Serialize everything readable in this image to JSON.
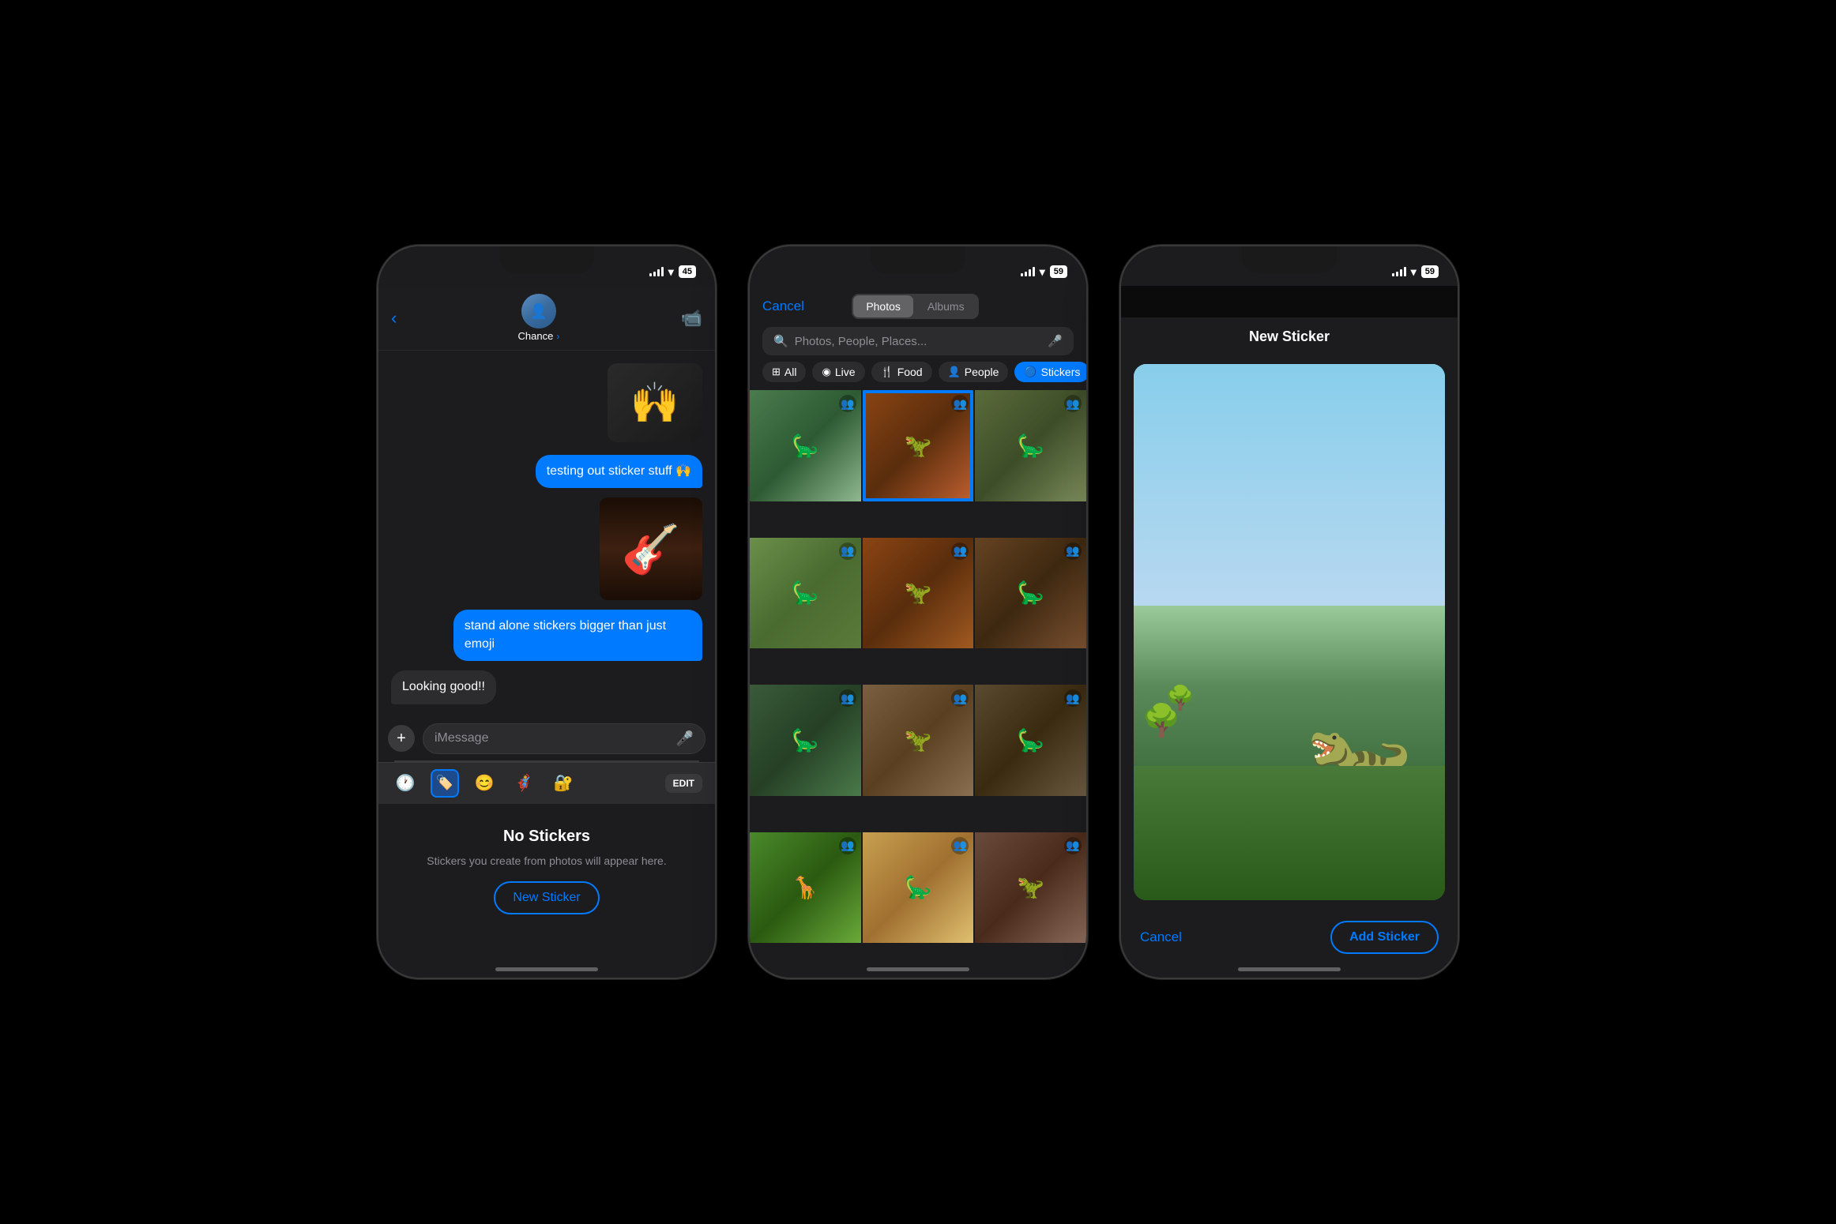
{
  "phone1": {
    "status_bar": {
      "time": "",
      "signal": "●●●●",
      "wifi": "wifi",
      "battery": "45"
    },
    "header": {
      "contact_name": "Chance",
      "contact_chevron": "›"
    },
    "messages": [
      {
        "type": "sent",
        "text": "testing out sticker stuff 🙌"
      },
      {
        "type": "sticker_sent",
        "emoji": "🎸"
      },
      {
        "type": "sent",
        "text": "stand alone stickers bigger than just emoji"
      },
      {
        "type": "received",
        "text": "Looking good!!"
      }
    ],
    "input_placeholder": "iMessage",
    "toolbar": {
      "edit_label": "EDIT"
    },
    "no_stickers": {
      "title": "No Stickers",
      "subtitle": "Stickers you create from photos\nwill appear here.",
      "button_label": "New Sticker"
    }
  },
  "phone2": {
    "status_bar": {
      "wifi": "wifi",
      "battery": "59"
    },
    "header": {
      "cancel_label": "Cancel",
      "seg_options": [
        "Photos",
        "Albums"
      ],
      "active_seg": "Photos"
    },
    "search": {
      "placeholder": "Photos, People, Places..."
    },
    "filters": [
      {
        "label": "All",
        "icon": "⊞",
        "active": false
      },
      {
        "label": "Live",
        "icon": "◉",
        "active": false
      },
      {
        "label": "Food",
        "icon": "🍴",
        "active": false
      },
      {
        "label": "People",
        "icon": "👤",
        "active": false
      },
      {
        "label": "Stickers",
        "icon": "🔵",
        "active": true
      }
    ],
    "photos": [
      {
        "id": 1,
        "type": "dino-1",
        "people": true
      },
      {
        "id": 2,
        "type": "dino-selected",
        "people": true,
        "selected": true
      },
      {
        "id": 3,
        "type": "dino-2",
        "people": true
      },
      {
        "id": 4,
        "type": "dino-3",
        "people": true
      },
      {
        "id": 5,
        "type": "dino-4",
        "people": true
      },
      {
        "id": 6,
        "type": "dino-5",
        "people": true
      },
      {
        "id": 7,
        "type": "dino-6",
        "people": true
      },
      {
        "id": 8,
        "type": "dino-7",
        "people": true
      },
      {
        "id": 9,
        "type": "dino-8",
        "people": true
      },
      {
        "id": 10,
        "type": "dino-9",
        "people": true
      },
      {
        "id": 11,
        "type": "dino-10",
        "people": true
      },
      {
        "id": 12,
        "type": "dino-11",
        "people": true
      }
    ]
  },
  "phone3": {
    "status_bar": {
      "wifi": "wifi",
      "battery": "59"
    },
    "header": {
      "title": "New Sticker"
    },
    "footer": {
      "cancel_label": "Cancel",
      "add_label": "Add Sticker"
    }
  }
}
